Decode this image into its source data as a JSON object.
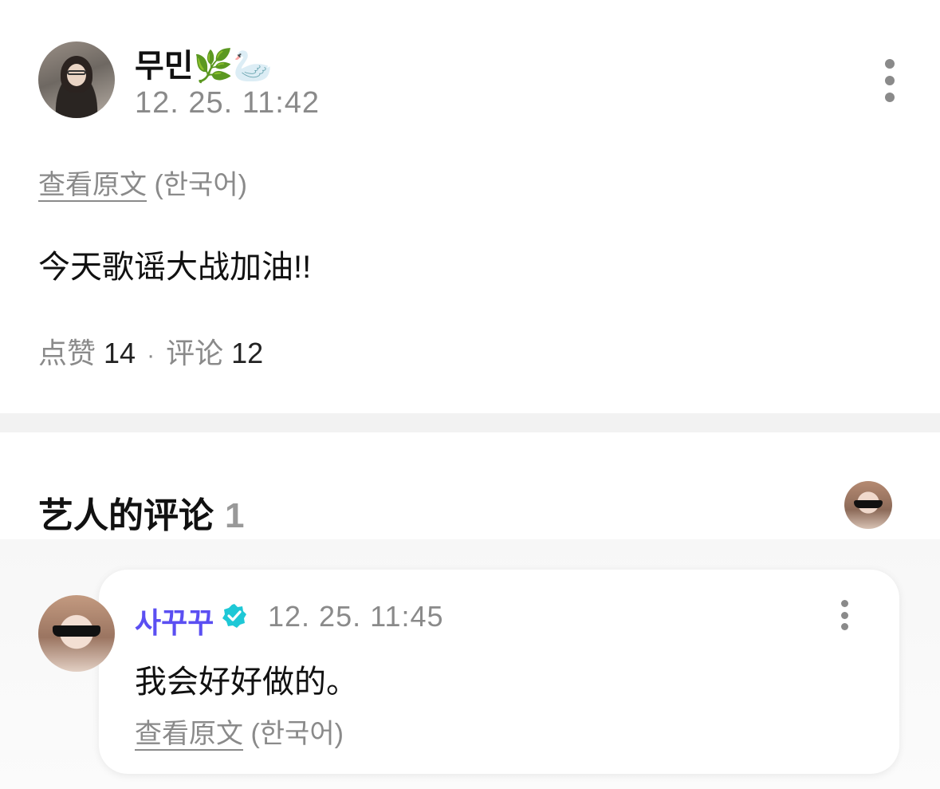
{
  "post": {
    "author": "무민",
    "author_emoji": "🌿🦢",
    "time": "12. 25. 11:42",
    "translate_link": "查看原文",
    "translate_lang": "(한국어)",
    "body": "今天歌谣大战加油!!",
    "likes_label": "点赞",
    "likes_count": "14",
    "separator": "·",
    "comments_label": "评论",
    "comments_count": "12"
  },
  "artist_comments": {
    "title": "艺人的评论",
    "count": "1",
    "items": [
      {
        "name": "사꾸꾸",
        "verified": true,
        "time": "12. 25. 11:45",
        "body": "我会好好做的。",
        "translate_link": "查看原文",
        "translate_lang": "(한국어)"
      }
    ]
  },
  "colors": {
    "artist_name": "#5b4ff2",
    "verified_badge": "#1ec8d6",
    "muted_text": "#8a8a8a",
    "divider": "#f2f2f2"
  },
  "icons": {
    "post_more": "more-vertical-icon",
    "comment_more": "more-vertical-icon",
    "verified": "verified-badge-icon"
  }
}
